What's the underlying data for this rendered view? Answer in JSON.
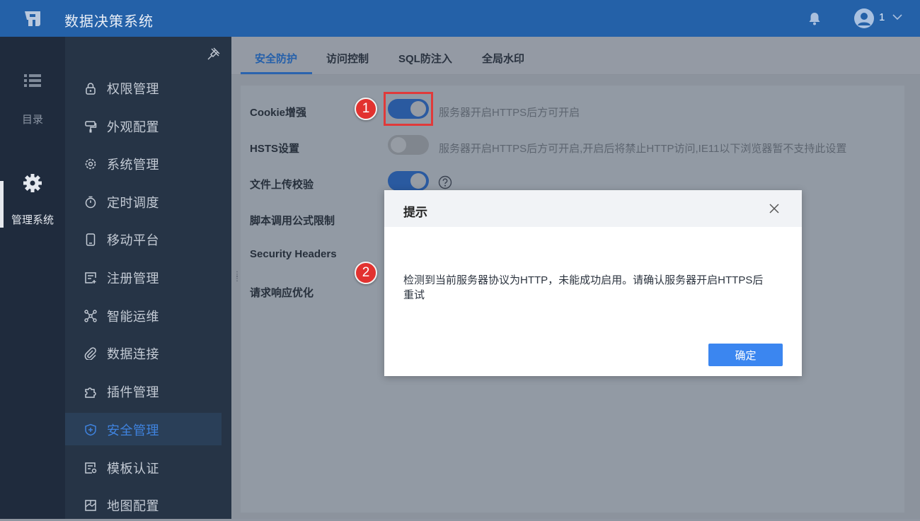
{
  "header": {
    "app_title": "数据决策系统",
    "user_name": "1"
  },
  "rail": {
    "catalog_label": "目录",
    "admin_label": "管理系统"
  },
  "menu": {
    "items": [
      "权限管理",
      "外观配置",
      "系统管理",
      "定时调度",
      "移动平台",
      "注册管理",
      "智能运维",
      "数据连接",
      "插件管理",
      "安全管理",
      "模板认证",
      "地图配置"
    ],
    "active": "安全管理"
  },
  "tabs": [
    "安全防护",
    "访问控制",
    "SQL防注入",
    "全局水印"
  ],
  "settings": {
    "cookie_label": "Cookie增强",
    "cookie_hint": "服务器开启HTTPS后方可开启",
    "hsts_label": "HSTS设置",
    "hsts_hint": "服务器开启HTTPS后方可开启,开启后将禁止HTTP访问,IE11以下浏览器暂不支持此设置",
    "upload_label": "文件上传校验",
    "script_label": "脚本调用公式限制",
    "security_headers_label": "Security Headers",
    "response_label": "请求响应优化",
    "cookie_enabled": true,
    "hsts_enabled": false,
    "upload_enabled": true
  },
  "annotations": {
    "marker1": "1",
    "marker2": "2"
  },
  "dialog": {
    "title": "提示",
    "message_line1": "检测到当前服务器协议为HTTP，未能成功启用。请确认服务器开启HTTPS后",
    "message_line2": "重试",
    "confirm_label": "确定"
  },
  "colors": {
    "topbar": "#2461a8",
    "accent": "#3b86f0",
    "highlight": "#e03a3a"
  }
}
